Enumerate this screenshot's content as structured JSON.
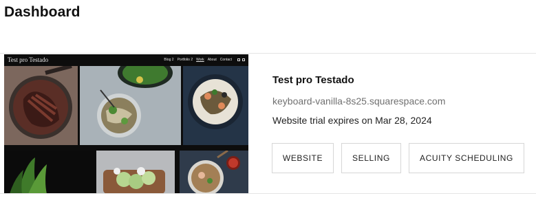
{
  "page": {
    "title": "Dashboard"
  },
  "site": {
    "title": "Test pro Testado",
    "url": "keyboard-vanilla-8s25.squarespace.com",
    "trial": "Website trial expires on Mar 28, 2024",
    "thumbnail": {
      "brand": "Test pro Testado",
      "nav": [
        "Blog 2",
        "Portfolio 2",
        "Work",
        "About",
        "Contact"
      ],
      "active_nav": "Work",
      "social_icons": [
        "instagram-icon",
        "twitter-icon"
      ]
    },
    "actions": {
      "website": "WEBSITE",
      "selling": "SELLING",
      "acuity": "ACUITY SCHEDULING"
    }
  }
}
